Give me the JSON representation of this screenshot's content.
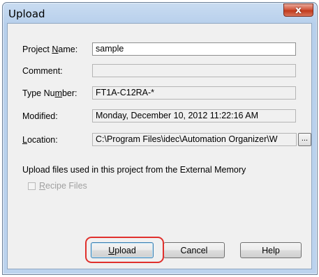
{
  "window": {
    "title": "Upload",
    "close_symbol": "x"
  },
  "fields": {
    "project_name": {
      "label_pre": "Project ",
      "label_mn": "N",
      "label_post": "ame:",
      "value": "sample"
    },
    "comment": {
      "label": "Comment:",
      "value": ""
    },
    "type_number": {
      "label_pre": "Type Nu",
      "label_mn": "m",
      "label_post": "ber:",
      "value": "FT1A-C12RA-*"
    },
    "modified": {
      "label": "Modified:",
      "value": "Monday, December 10, 2012 11:22:16 AM"
    },
    "location": {
      "label_mn": "L",
      "label_post": "ocation:",
      "value": "C:\\Program Files\\idec\\Automation Organizer\\W"
    }
  },
  "browse_label": "...",
  "upload_files_text": "Upload files used in this project from the External Memory",
  "recipe": {
    "label_mn": "R",
    "label_post": "ecipe Files",
    "checked": false
  },
  "buttons": {
    "upload": {
      "mn": "U",
      "rest": "pload"
    },
    "cancel": "Cancel",
    "help": "Help"
  },
  "icons": {
    "close": "close-icon"
  },
  "colors": {
    "highlight_ring": "#e0302c",
    "close_button": "#c03a1c"
  }
}
